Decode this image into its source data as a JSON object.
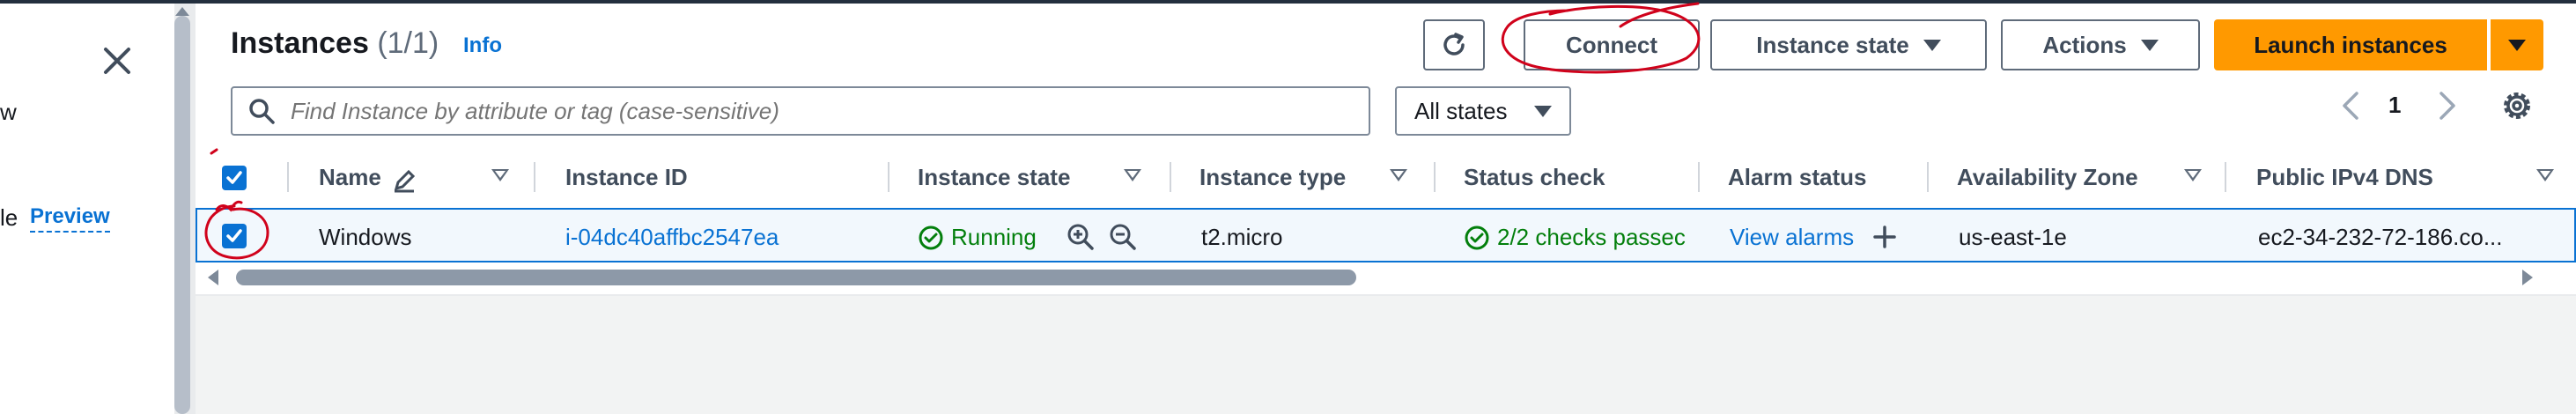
{
  "sidebar": {
    "close_label": "×",
    "text_fragment_1": "w",
    "text_fragment_2": "le",
    "preview_link": "Preview"
  },
  "header": {
    "title": "Instances",
    "count": "(1/1)",
    "info_link": "Info"
  },
  "toolbar": {
    "refresh_icon": "refresh-icon",
    "connect_label": "Connect",
    "instance_state_label": "Instance state",
    "actions_label": "Actions",
    "launch_label": "Launch instances"
  },
  "search": {
    "placeholder": "Find Instance by attribute or tag (case-sensitive)",
    "value": ""
  },
  "filter": {
    "selected": "All states"
  },
  "pagination": {
    "current_page": "1"
  },
  "table": {
    "columns": [
      "Name",
      "Instance ID",
      "Instance state",
      "Instance type",
      "Status check",
      "Alarm status",
      "Availability Zone",
      "Public IPv4 DNS"
    ],
    "rows": [
      {
        "name": "Windows",
        "instance_id": "i-04dc40affbc2547ea",
        "instance_state": "Running",
        "instance_type": "t2.micro",
        "status_check": "2/2 checks passec",
        "alarm_status": "View alarms",
        "availability_zone": "us-east-1e",
        "public_dns": "ec2-34-232-72-186.co..."
      }
    ]
  },
  "colors": {
    "primary_link": "#0972d3",
    "success": "#037f0c",
    "launch_button": "#ff9900",
    "annotation_red": "#d0021b"
  }
}
